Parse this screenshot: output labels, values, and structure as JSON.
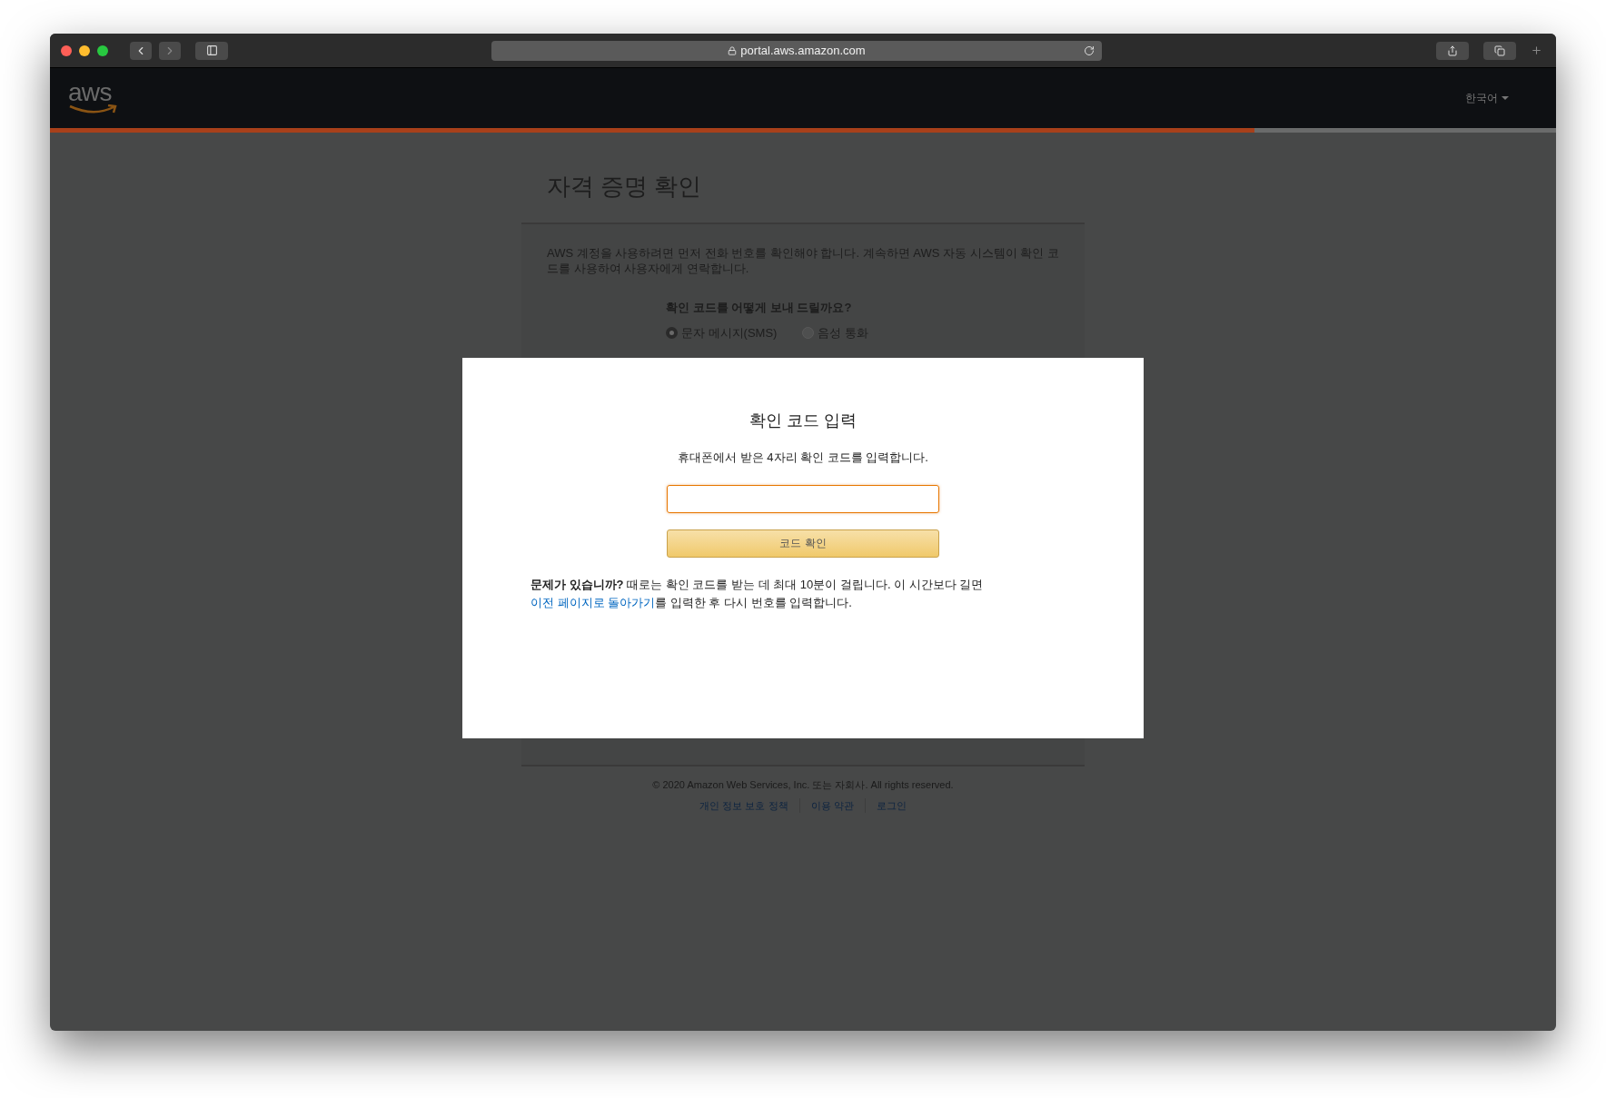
{
  "browser": {
    "url": "portal.aws.amazon.com"
  },
  "header": {
    "logo": "aws",
    "language": "한국어",
    "progress": {
      "level": 0.8
    }
  },
  "page": {
    "title": "자격 증명 확인",
    "intro": "AWS 계정을 사용하려면 먼저 전화 번호를 확인해야 합니다. 계속하면 AWS 자동 시스템이 확인 코드를 사용하여 사용자에게 연락합니다.",
    "question": "확인 코드를 어떻게 보내 드릴까요?",
    "options": [
      {
        "label": "문자 메시지(SMS)",
        "selected": true
      },
      {
        "label": "음성 통화",
        "selected": false
      }
    ],
    "footer": {
      "copyright": "© 2020 Amazon Web Services, Inc. 또는 자회사. All rights reserved.",
      "links": [
        "개인 정보 보호 정책",
        "이용 약관",
        "로그인"
      ]
    }
  },
  "modal": {
    "title": "확인 코드 입력",
    "instruction": "휴대폰에서 받은 4자리 확인 코드를 입력합니다.",
    "button": "코드 확인",
    "help": {
      "before": "**문제가 있습니까?** 때로는 확인 코드를 받는 데 최대 10분이 걸립니다. 이 시간보다 길면 ",
      "link": "이전 페이지로 돌아가기",
      "after": "를 입력한 후 다시 번호를 입력합니다."
    }
  }
}
